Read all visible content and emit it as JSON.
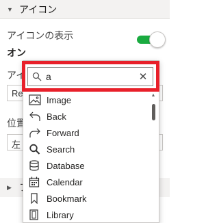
{
  "section": {
    "title": "アイコン"
  },
  "show_icon": {
    "label": "アイコンの表示",
    "state": "オン",
    "enabled": true
  },
  "icon_row": {
    "label_partial": "アイ",
    "value_partial": "Re"
  },
  "position_row": {
    "label_partial": "位置",
    "value_partial": "左"
  },
  "collapsed_section": {
    "title_partial": "フ"
  },
  "search": {
    "value": "a"
  },
  "icons": [
    {
      "name": "image-icon",
      "label": "Image"
    },
    {
      "name": "back-icon",
      "label": "Back"
    },
    {
      "name": "forward-icon",
      "label": "Forward"
    },
    {
      "name": "search-icon",
      "label": "Search"
    },
    {
      "name": "database-icon",
      "label": "Database"
    },
    {
      "name": "calendar-icon",
      "label": "Calendar"
    },
    {
      "name": "bookmark-icon",
      "label": "Bookmark"
    },
    {
      "name": "library-icon",
      "label": "Library"
    }
  ],
  "colors": {
    "toggle_on": "#1aab40",
    "highlight": "#e8202a"
  }
}
